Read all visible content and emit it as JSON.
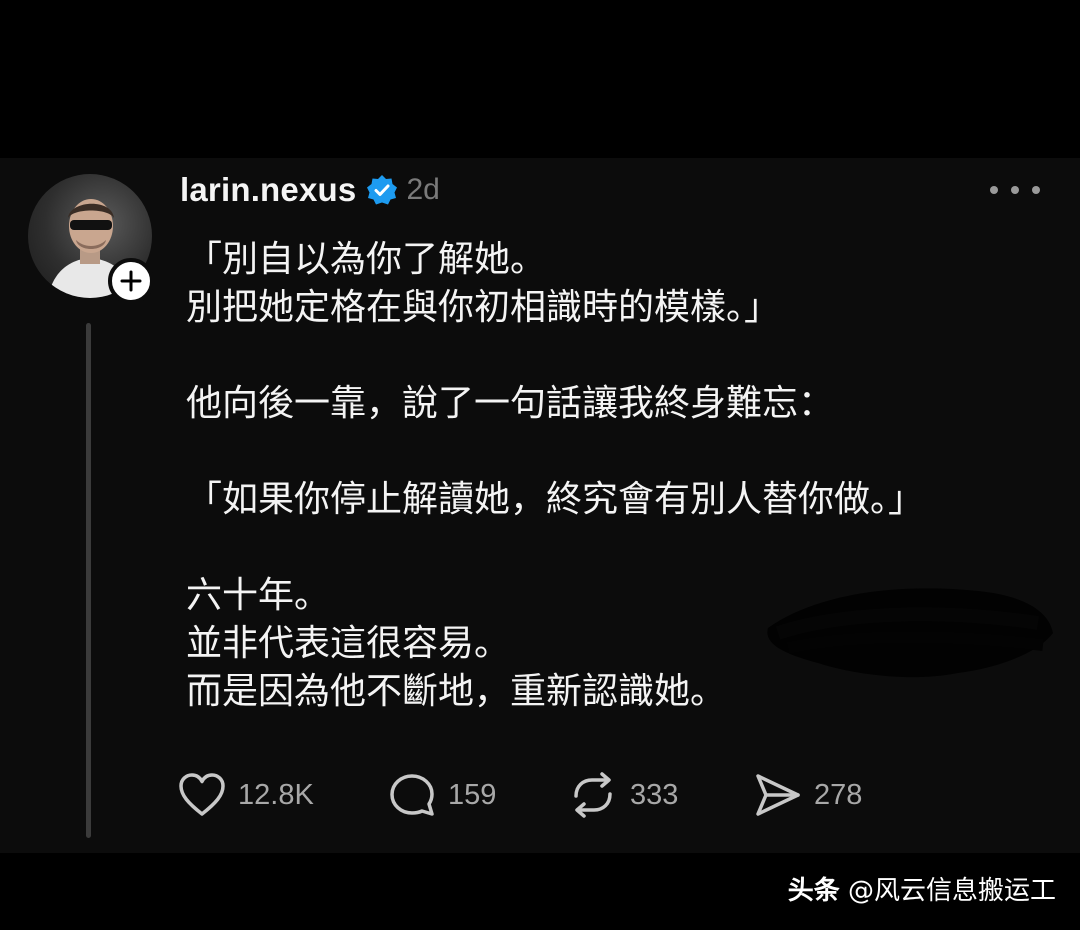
{
  "post": {
    "username": "larin.nexus",
    "time": "2d",
    "verified": true,
    "body_lines": [
      "「別自以為你了解她。",
      "別把她定格在與你初相識時的模樣。」",
      "",
      "他向後一靠，說了一句話讓我終身難忘：",
      "",
      "「如果你停止解讀她，終究會有別人替你做。」",
      "",
      "六十年。",
      "並非代表這很容易。",
      "而是因為他不斷地，重新認識她。"
    ]
  },
  "actions": {
    "like": {
      "icon": "heart-icon",
      "count": "12.8K"
    },
    "comment": {
      "icon": "comment-bubble-icon",
      "count": "159"
    },
    "repost": {
      "icon": "repost-icon",
      "count": "333"
    },
    "share": {
      "icon": "send-icon",
      "count": "278"
    }
  },
  "watermark": {
    "brand": "头条",
    "handle": "@风云信息搬运工"
  },
  "colors": {
    "verified_blue": "#1d9bf0",
    "muted_text": "#7a7a7a",
    "post_background": "#0c0c0c"
  }
}
